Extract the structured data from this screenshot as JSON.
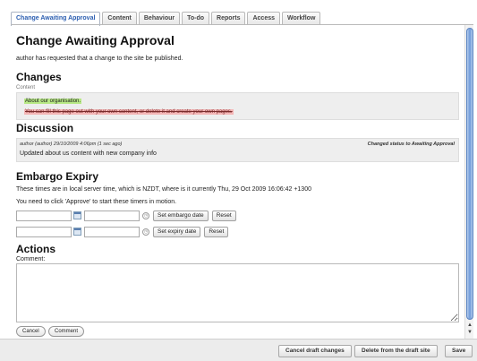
{
  "tabs": [
    {
      "label": "Change Awaiting Approval",
      "active": true
    },
    {
      "label": "Content"
    },
    {
      "label": "Behaviour"
    },
    {
      "label": "To-do"
    },
    {
      "label": "Reports"
    },
    {
      "label": "Access"
    },
    {
      "label": "Workflow"
    }
  ],
  "main": {
    "title": "Change Awaiting Approval",
    "request_text": "author has requested that a change to the site be published."
  },
  "changes": {
    "heading": "Changes",
    "field_label": "Content",
    "inserted": "About our organisation.",
    "deleted": "You can fill this page out with your own content, or delete it and create your own pages."
  },
  "discussion": {
    "heading": "Discussion",
    "meta": "author (author) 29/10/2009 4:06pm (1 sec ago)",
    "status": "Changed status to Awaiting Approval",
    "text": "Updated about us content with new company info"
  },
  "embargo": {
    "heading": "Embargo Expiry",
    "timezone_text": "These times are in local server time, which is NZDT, where is it currently Thu, 29 Oct 2009 16:06:42 +1300",
    "approve_text": "You need to click 'Approve' to start these timers in motion.",
    "set_embargo_label": "Set embargo date",
    "set_expiry_label": "Set expiry date",
    "reset_label": "Reset"
  },
  "actions": {
    "heading": "Actions",
    "comment_label": "Comment:",
    "cancel_label": "Cancel",
    "comment_button_label": "Comment"
  },
  "bottombar": {
    "cancel_draft_label": "Cancel draft changes",
    "delete_draft_label": "Delete from the draft site",
    "save_label": "Save"
  },
  "colors": {
    "inserted_bg": "#b8e986",
    "deleted_bg": "#f4b6b6",
    "active_tab_text": "#2a5db0",
    "scroll_thumb": "#6e9ad8"
  },
  "icons": {
    "calendar": "calendar-icon",
    "clock": "clock-icon",
    "scroll_up": "scroll-up-arrow-icon",
    "scroll_down": "scroll-down-arrow-icon"
  }
}
